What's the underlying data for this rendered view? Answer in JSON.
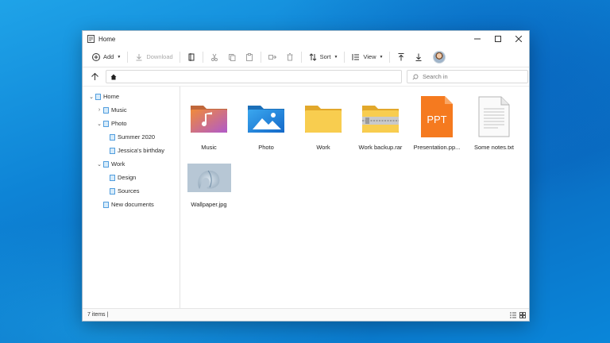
{
  "window": {
    "title": "Home"
  },
  "toolbar": {
    "add_label": "Add",
    "download_label": "Download",
    "sort_label": "Sort",
    "view_label": "View"
  },
  "address": {
    "search_placeholder": "Search in"
  },
  "sidebar": {
    "items": [
      {
        "label": "Home"
      },
      {
        "label": "Music"
      },
      {
        "label": "Photo"
      },
      {
        "label": "Summer 2020"
      },
      {
        "label": "Jessica's birthday"
      },
      {
        "label": "Work"
      },
      {
        "label": "Design"
      },
      {
        "label": "Sources"
      },
      {
        "label": "New documents"
      }
    ]
  },
  "files": [
    {
      "label": "Music",
      "icon": "music-folder-icon"
    },
    {
      "label": "Photo",
      "icon": "photo-folder-icon"
    },
    {
      "label": "Work",
      "icon": "folder-icon"
    },
    {
      "label": "Work backup.rar",
      "icon": "zip-folder-icon"
    },
    {
      "label": "Presentation.pp...",
      "icon": "ppt-file-icon",
      "badge": "PPT"
    },
    {
      "label": "Some notes.txt",
      "icon": "text-file-icon"
    },
    {
      "label": "Wallpaper.jpg",
      "icon": "image-thumbnail"
    }
  ],
  "status": {
    "count_text": "7 items |"
  },
  "colors": {
    "accent": "#2b88d8",
    "folder": "#f5c542",
    "ppt": "#f57a1f"
  }
}
